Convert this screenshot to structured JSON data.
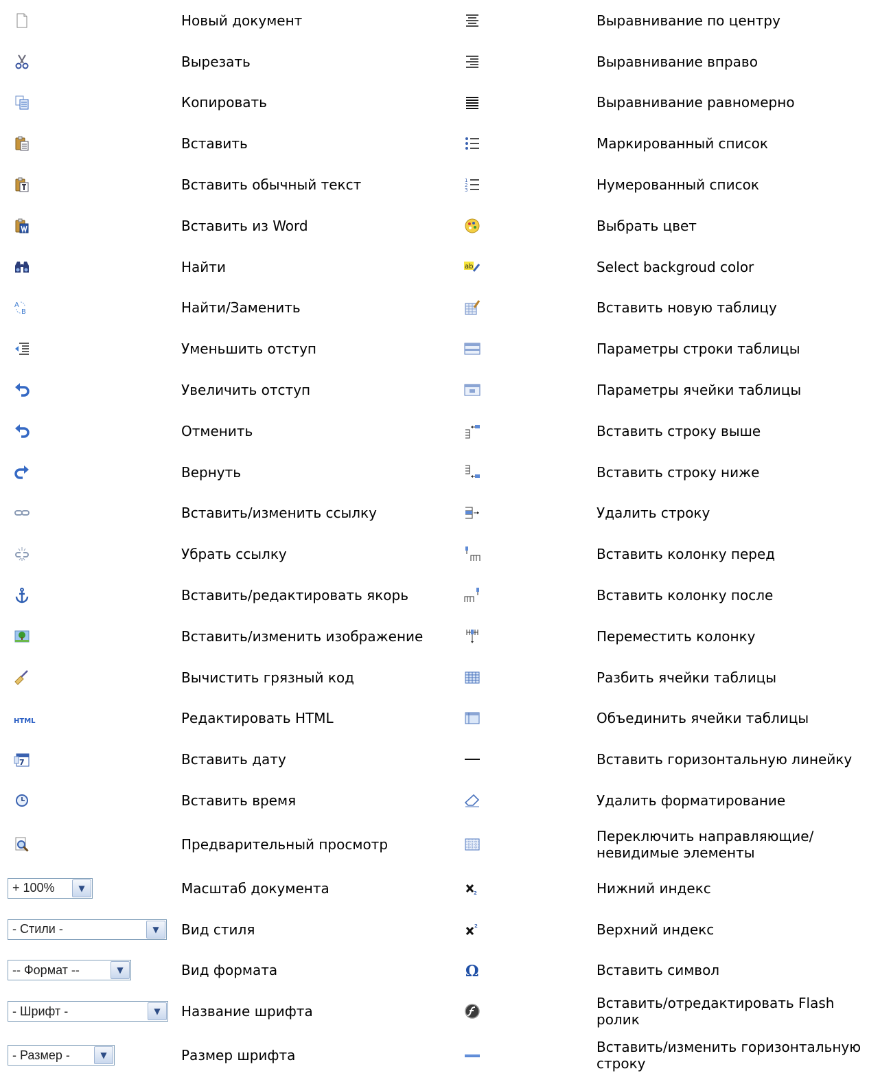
{
  "left": [
    {
      "icon": "new-document-icon",
      "label": "Новый документ"
    },
    {
      "icon": "scissors-icon",
      "label": "Вырезать"
    },
    {
      "icon": "copy-icon",
      "label": "Копировать"
    },
    {
      "icon": "paste-icon",
      "label": "Вставить"
    },
    {
      "icon": "paste-text-icon",
      "label": "Вставить обычный текст"
    },
    {
      "icon": "paste-word-icon",
      "label": "Вставить из Word"
    },
    {
      "icon": "binoculars-icon",
      "label": "Найти"
    },
    {
      "icon": "replace-icon",
      "label": "Найти/Заменить"
    },
    {
      "icon": "outdent-icon",
      "label": "Уменьшить отступ"
    },
    {
      "icon": "indent-icon",
      "label": "Увеличить отступ"
    },
    {
      "icon": "undo-icon",
      "label": "Отменить"
    },
    {
      "icon": "redo-icon",
      "label": "Вернуть"
    },
    {
      "icon": "link-icon",
      "label": "Вставить/изменить ссылку"
    },
    {
      "icon": "unlink-icon",
      "label": "Убрать ссылку"
    },
    {
      "icon": "anchor-icon",
      "label": "Вставить/редактировать якорь"
    },
    {
      "icon": "image-icon",
      "label": "Вставить/изменить изображение"
    },
    {
      "icon": "broom-icon",
      "label": "Вычистить грязный код"
    },
    {
      "icon": "html-icon",
      "label": "Редактировать HTML",
      "icon_text": "HTML"
    },
    {
      "icon": "calendar-icon",
      "label": "Вставить дату"
    },
    {
      "icon": "clock-icon",
      "label": "Вставить время"
    },
    {
      "icon": "preview-icon",
      "label": "Предварительный просмотр"
    }
  ],
  "left_selects": [
    {
      "text": "+ 100%",
      "label": "Масштаб документа"
    },
    {
      "text": "- Стили -",
      "label": "Вид стиля"
    },
    {
      "text": "-- Формат --",
      "label": "Вид формата"
    },
    {
      "text": "- Шрифт -",
      "label": "Название шрифта"
    },
    {
      "text": "- Размер -",
      "label": "Размер шрифта"
    }
  ],
  "right": [
    {
      "icon": "align-center-icon",
      "label": "Выравнивание по центру"
    },
    {
      "icon": "align-right-icon",
      "label": "Выравнивание вправо"
    },
    {
      "icon": "align-justify-icon",
      "label": "Выравнивание равномерно"
    },
    {
      "icon": "bulleted-list-icon",
      "label": "Маркированный список"
    },
    {
      "icon": "numbered-list-icon",
      "label": "Нумерованный список"
    },
    {
      "icon": "palette-icon",
      "label": "Выбрать цвет"
    },
    {
      "icon": "highlight-icon",
      "label": "Select backgroud color"
    },
    {
      "icon": "insert-table-icon",
      "label": "Вставить новую таблицу"
    },
    {
      "icon": "table-row-props-icon",
      "label": "Параметры строки таблицы"
    },
    {
      "icon": "table-cell-props-icon",
      "label": "Параметры ячейки таблицы"
    },
    {
      "icon": "row-above-icon",
      "label": "Вставить строку выше"
    },
    {
      "icon": "row-below-icon",
      "label": "Вставить строку ниже"
    },
    {
      "icon": "delete-row-icon",
      "label": "Удалить строку"
    },
    {
      "icon": "col-before-icon",
      "label": "Вставить колонку перед"
    },
    {
      "icon": "col-after-icon",
      "label": "Вставить колонку после"
    },
    {
      "icon": "move-col-icon",
      "label": "Переместить колонку"
    },
    {
      "icon": "split-cells-icon",
      "label": "Разбить ячейки таблицы"
    },
    {
      "icon": "merge-cells-icon",
      "label": "Объединить ячейки таблицы"
    },
    {
      "icon": "hr-icon",
      "label": "Вставить горизонтальную линейку"
    },
    {
      "icon": "eraser-icon",
      "label": "Удалить форматирование"
    },
    {
      "icon": "guides-icon",
      "label": "Переключить направляющие/невидимые элементы"
    },
    {
      "icon": "subscript-icon",
      "label": "Нижний индекс"
    },
    {
      "icon": "superscript-icon",
      "label": "Верхний индекс"
    },
    {
      "icon": "omega-icon",
      "label": "Вставить символ"
    },
    {
      "icon": "flash-icon",
      "label": "Вставить/отредактировать Flash ролик"
    },
    {
      "icon": "hrule-icon",
      "label": "Вставить/изменить горизонтальную строку"
    }
  ]
}
